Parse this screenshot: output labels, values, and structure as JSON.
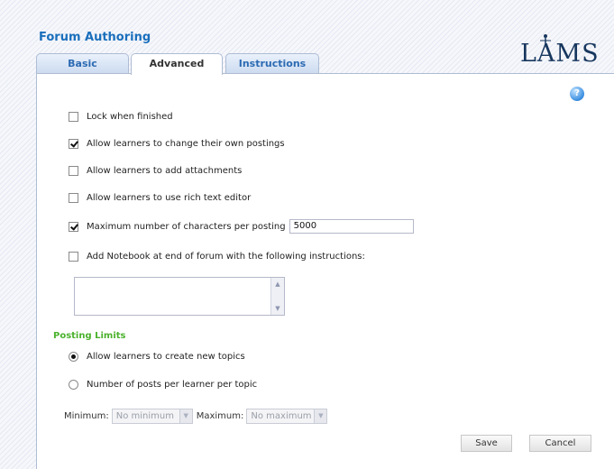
{
  "app": {
    "title": "Forum Authoring",
    "logo_text": "LAMS"
  },
  "tabs": [
    {
      "label": "Basic",
      "active": false
    },
    {
      "label": "Advanced",
      "active": true
    },
    {
      "label": "Instructions",
      "active": false
    }
  ],
  "help": {
    "icon": "help-icon",
    "glyph": "?"
  },
  "options": [
    {
      "label": "Lock when finished",
      "checked": false
    },
    {
      "label": "Allow learners to change their own postings",
      "checked": true
    },
    {
      "label": "Allow learners to add attachments",
      "checked": false
    },
    {
      "label": "Allow learners to use rich text editor",
      "checked": false
    },
    {
      "label": "Maximum number of characters per posting",
      "checked": true,
      "value": "5000"
    },
    {
      "label": "Add Notebook at end of forum with the following instructions:",
      "checked": false
    }
  ],
  "notebook_instructions": "",
  "posting_limits": {
    "title": "Posting Limits",
    "radios": [
      {
        "label": "Allow learners to create new topics",
        "checked": true
      },
      {
        "label": "Number of posts per learner per topic",
        "checked": false
      }
    ],
    "minimum_label": "Minimum:",
    "minimum_value": "No minimum",
    "maximum_label": "Maximum:",
    "maximum_value": "No maximum"
  },
  "buttons": {
    "save": "Save",
    "cancel": "Cancel"
  }
}
